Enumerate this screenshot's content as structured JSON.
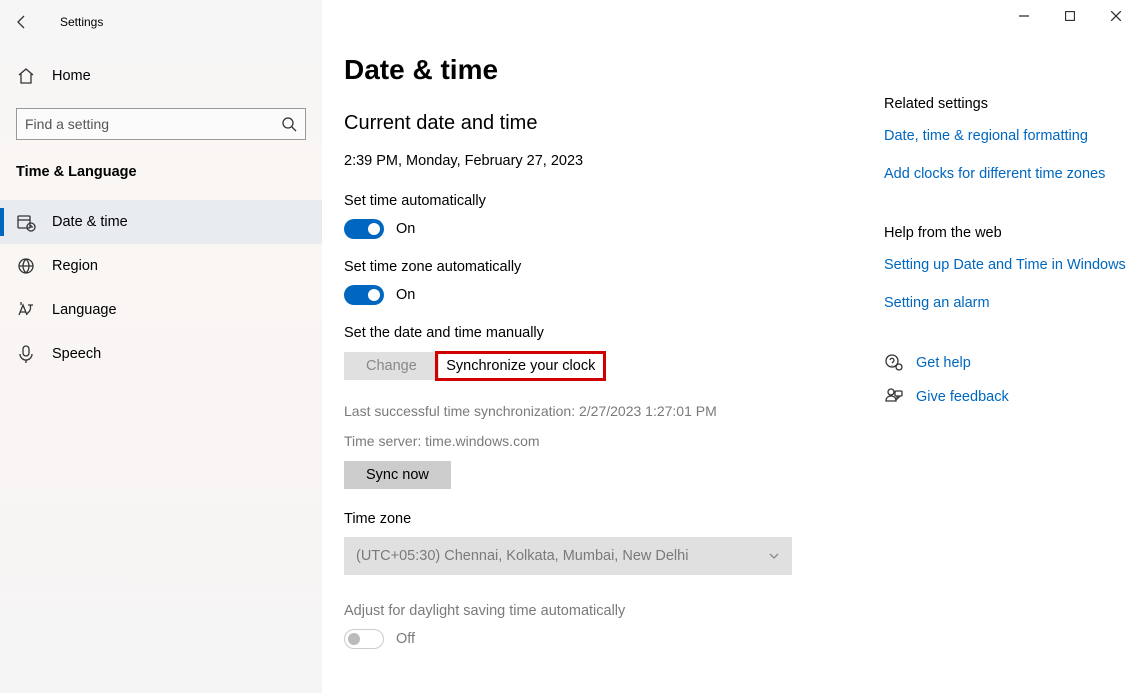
{
  "app_title": "Settings",
  "home_label": "Home",
  "search_placeholder": "Find a setting",
  "category_title": "Time & Language",
  "nav": [
    {
      "label": "Date & time"
    },
    {
      "label": "Region"
    },
    {
      "label": "Language"
    },
    {
      "label": "Speech"
    }
  ],
  "page_title": "Date & time",
  "current": {
    "heading": "Current date and time",
    "value": "2:39 PM, Monday, February 27, 2023"
  },
  "set_time_auto": {
    "label": "Set time automatically",
    "state": "On"
  },
  "set_tz_auto": {
    "label": "Set time zone automatically",
    "state": "On"
  },
  "manual": {
    "label": "Set the date and time manually",
    "button": "Change"
  },
  "sync": {
    "heading": "Synchronize your clock",
    "last": "Last successful time synchronization: 2/27/2023 1:27:01 PM",
    "server": "Time server: time.windows.com",
    "button": "Sync now"
  },
  "timezone": {
    "label": "Time zone",
    "value": "(UTC+05:30) Chennai, Kolkata, Mumbai, New Delhi"
  },
  "dst": {
    "label": "Adjust for daylight saving time automatically",
    "state": "Off"
  },
  "aside": {
    "related_heading": "Related settings",
    "related_links": [
      "Date, time & regional formatting",
      "Add clocks for different time zones"
    ],
    "help_heading": "Help from the web",
    "help_links": [
      "Setting up Date and Time in Windows",
      "Setting an alarm"
    ],
    "get_help": "Get help",
    "feedback": "Give feedback"
  }
}
